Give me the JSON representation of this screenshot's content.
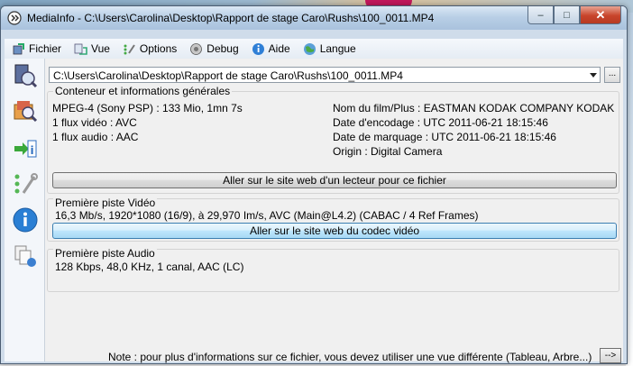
{
  "window": {
    "title": "MediaInfo - C:\\Users\\Carolina\\Desktop\\Rapport de stage Caro\\Rushs\\100_0011.MP4",
    "controls": {
      "minimize": "–",
      "maximize": "□",
      "close": "✕"
    }
  },
  "menu": [
    {
      "label": "Fichier",
      "icon": "file-open-icon"
    },
    {
      "label": "Vue",
      "icon": "view-icon"
    },
    {
      "label": "Options",
      "icon": "options-icon"
    },
    {
      "label": "Debug",
      "icon": "debug-icon"
    },
    {
      "label": "Aide",
      "icon": "help-icon"
    },
    {
      "label": "Langue",
      "icon": "language-globe-icon"
    }
  ],
  "sidebar_icons": [
    "open-media-icon",
    "open-folder-icon",
    "export-info-icon",
    "preferences-tools-icon",
    "about-info-icon",
    "copy-pages-icon"
  ],
  "path": {
    "value": "C:\\Users\\Carolina\\Desktop\\Rapport de stage Caro\\Rushs\\100_0011.MP4",
    "browse_label": "..."
  },
  "general": {
    "title": "Conteneur et informations générales",
    "left": [
      "MPEG-4 (Sony PSP) : 133 Mio, 1mn 7s",
      "1 flux vidéo : AVC",
      "1 flux audio : AAC"
    ],
    "right": [
      "Nom du film/Plus : EASTMAN KODAK COMPANY  KODAK",
      "Date d'encodage : UTC 2011-06-21 18:15:46",
      "Date de marquage : UTC 2011-06-21 18:15:46",
      "Origin : Digital Camera"
    ],
    "button": "Aller sur le site web d'un lecteur pour ce fichier"
  },
  "video": {
    "title": "Première piste Vidéo",
    "line": "16,3 Mb/s, 1920*1080 (16/9), à 29,970 Im/s, AVC (Main@L4.2) (CABAC / 4 Ref Frames)",
    "button": "Aller sur le site web du codec vidéo"
  },
  "audio": {
    "title": "Première piste Audio",
    "line": "128 Kbps, 48,0 KHz, 1 canal, AAC (LC)"
  },
  "footer": {
    "note": "Note : pour plus d'informations sur ce fichier, vous devez utiliser une vue différente (Tableau, Arbre...)",
    "next_label": "-->"
  },
  "colors": {
    "title_bar": "#b9cfe6",
    "close_button": "#c8442b",
    "focused_button": "#bee6fd",
    "panel_background": "#f0f0f0"
  }
}
